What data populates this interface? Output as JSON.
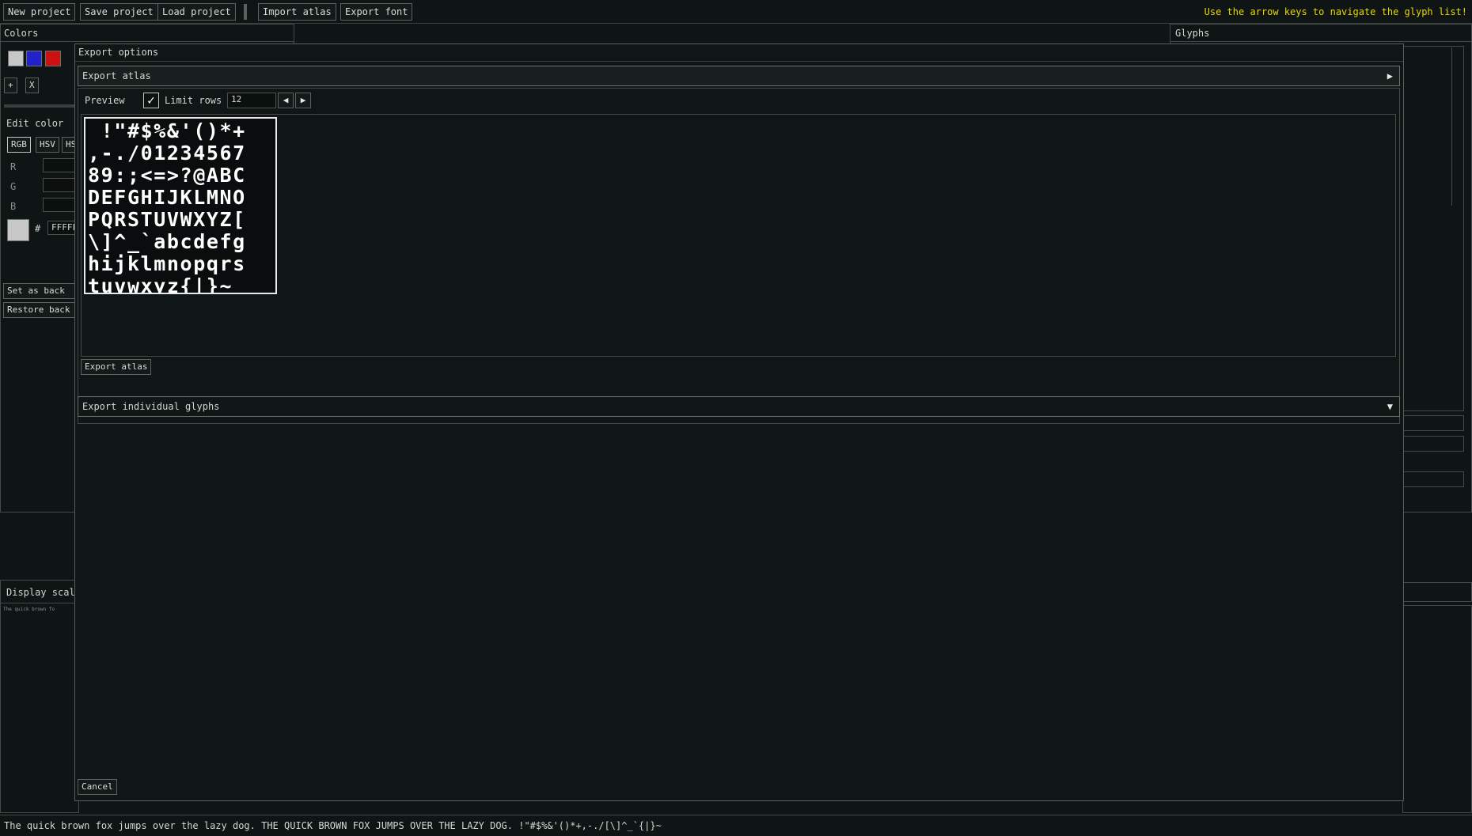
{
  "toolbar": {
    "new_project": "New project",
    "save_project": "Save project",
    "load_project": "Load project",
    "import_atlas": "Import atlas",
    "export_font": "Export font",
    "hint": "Use the arrow keys to navigate the glyph list!"
  },
  "colors_panel": {
    "title": "Colors",
    "swatches": [
      "#c8c8c8",
      "#2222cc",
      "#cc1111"
    ],
    "add_label": "+",
    "remove_label": "X",
    "edit_color_title": "Edit color",
    "modes": [
      "RGB",
      "HSV",
      "HS"
    ],
    "channels": [
      "R",
      "G",
      "B"
    ],
    "hash_label": "#",
    "hex_value": "FFFFF",
    "preview_color": "#c8c8c8",
    "set_background": "Set as back",
    "restore_background": "Restore back"
  },
  "glyphs_panel": {
    "title": "Glyphs"
  },
  "display_panel": {
    "title": "Display scal",
    "preview_text": "The quick brown fo"
  },
  "modal": {
    "title": "Export options",
    "export_atlas_section": {
      "title": "Export atlas",
      "preview_label": "Preview",
      "limit_rows_label": "Limit rows",
      "limit_rows_checked": true,
      "rows_value": "12",
      "atlas_lines": [
        " !\"#$%&'()*+",
        ",-./01234567",
        "89:;<=>?@ABC",
        "DEFGHIJKLMNO",
        "PQRSTUVWXYZ[",
        "\\]^_`abcdefg",
        "hijklmnopqrs",
        "tuvwxyz{|}~ "
      ],
      "export_button": "Export atlas"
    },
    "export_glyphs_section": {
      "title": "Export individual glyphs"
    },
    "cancel_button": "Cancel"
  },
  "status_bar": {
    "text": "The quick brown fox jumps over the lazy dog. THE QUICK BROWN FOX JUMPS OVER THE LAZY DOG. !\"#$%&'()*+,-./[\\]^_`{|}~"
  }
}
